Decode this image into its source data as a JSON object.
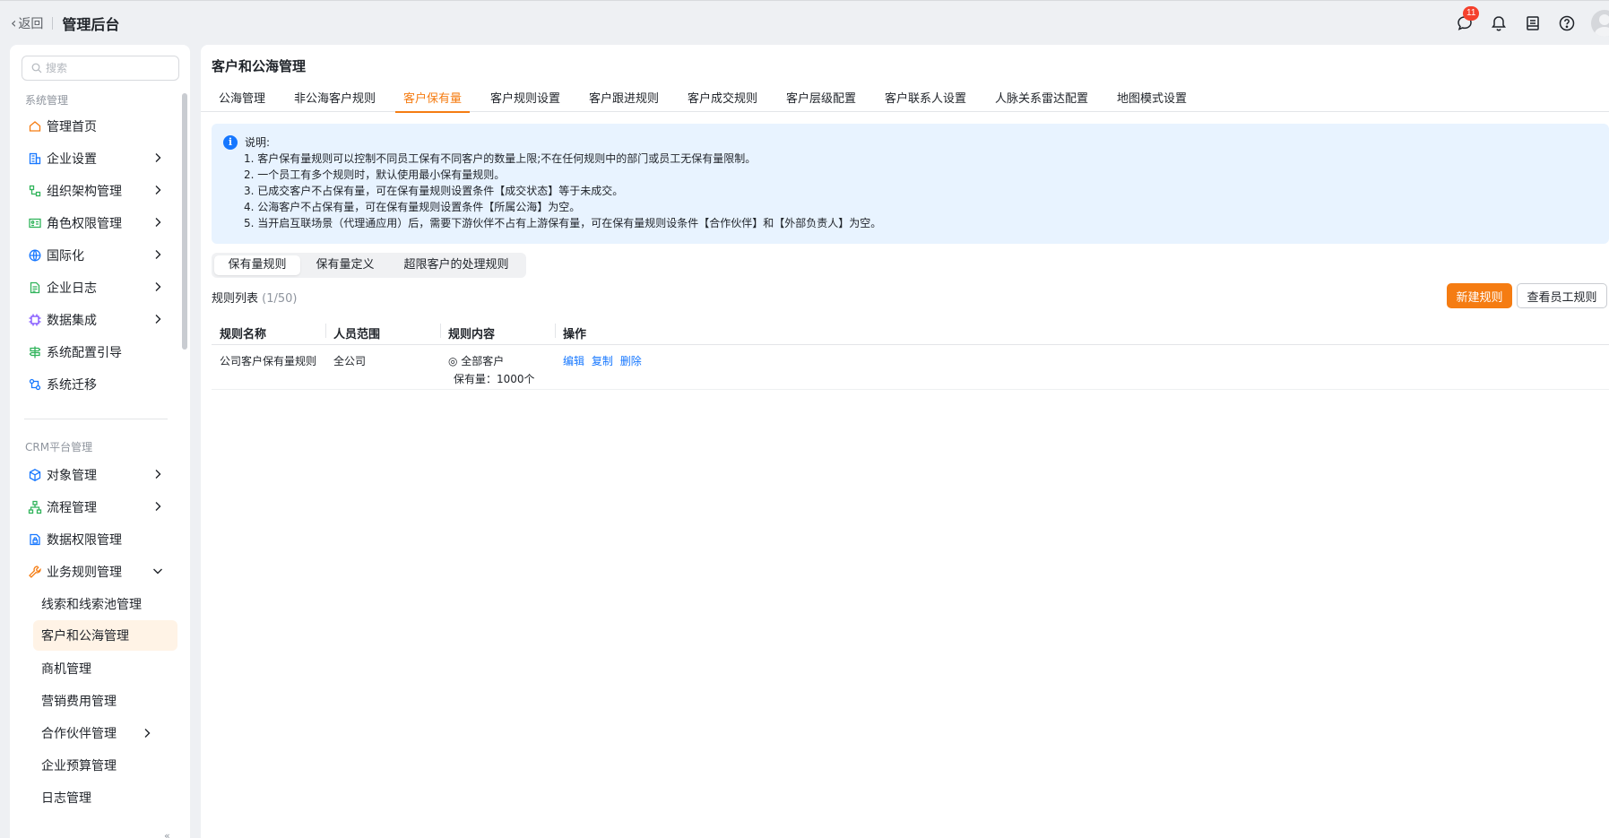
{
  "topbar": {
    "back_label": "返回",
    "title": "管理后台",
    "message_badge": "11"
  },
  "sidebar": {
    "search_placeholder": "搜索",
    "section_system": "系统管理",
    "system_items": [
      {
        "label": "管理首页",
        "icon": "home-icon"
      },
      {
        "label": "企业设置",
        "icon": "building-icon"
      },
      {
        "label": "组织架构管理",
        "icon": "org-icon"
      },
      {
        "label": "角色权限管理",
        "icon": "id-card-icon"
      },
      {
        "label": "国际化",
        "icon": "globe-icon"
      },
      {
        "label": "企业日志",
        "icon": "document-icon"
      },
      {
        "label": "数据集成",
        "icon": "chip-icon"
      },
      {
        "label": "系统配置引导",
        "icon": "signpost-icon"
      },
      {
        "label": "系统迁移",
        "icon": "migrate-icon"
      }
    ],
    "section_crm": "CRM平台管理",
    "crm_items": [
      {
        "label": "对象管理",
        "icon": "cube-icon"
      },
      {
        "label": "流程管理",
        "icon": "flow-icon"
      },
      {
        "label": "数据权限管理",
        "icon": "data-lock-icon"
      },
      {
        "label": "业务规则管理",
        "icon": "wrench-icon"
      }
    ],
    "sub_items": [
      {
        "label": "线索和线索池管理"
      },
      {
        "label": "客户和公海管理"
      },
      {
        "label": "商机管理"
      },
      {
        "label": "营销费用管理"
      },
      {
        "label": "合作伙伴管理"
      },
      {
        "label": "企业预算管理"
      },
      {
        "label": "日志管理"
      }
    ],
    "collapse_glyph": "«"
  },
  "main": {
    "title": "客户和公海管理",
    "tabs": [
      {
        "label": "公海管理"
      },
      {
        "label": "非公海客户规则"
      },
      {
        "label": "客户保有量"
      },
      {
        "label": "客户规则设置"
      },
      {
        "label": "客户跟进规则"
      },
      {
        "label": "客户成交规则"
      },
      {
        "label": "客户层级配置"
      },
      {
        "label": "客户联系人设置"
      },
      {
        "label": "人脉关系雷达配置"
      },
      {
        "label": "地图模式设置"
      }
    ],
    "active_tab": "客户保有量",
    "notice": {
      "title": "说明:",
      "lines": [
        "1. 客户保有量规则可以控制不同员工保有不同客户的数量上限;不在任何规则中的部门或员工无保有量限制。",
        "2. 一个员工有多个规则时，默认使用最小保有量规则。",
        "3. 已成交客户不占保有量，可在保有量规则设置条件【成交状态】等于未成交。",
        "4. 公海客户不占保有量，可在保有量规则设置条件【所属公海】为空。",
        "5. 当开启互联场景（代理通应用）后，需要下游伙伴不占有上游保有量，可在保有量规则设条件【合作伙伴】和【外部负责人】为空。"
      ]
    },
    "segments": [
      {
        "label": "保有量规则"
      },
      {
        "label": "保有量定义"
      },
      {
        "label": "超限客户的处理规则"
      }
    ],
    "list_title": "规则列表",
    "list_count": "(1/50)",
    "new_rule_button": "新建规则",
    "view_staff_rules_button": "查看员工规则",
    "table": {
      "headers": [
        "规则名称",
        "人员范围",
        "规则内容",
        "操作"
      ],
      "rows": [
        {
          "name": "公司客户保有量规则",
          "scope": "全公司",
          "content_line1": "◎ 全部客户",
          "content_line2": "保有量：1000个",
          "actions": [
            "编辑",
            "复制",
            "删除"
          ]
        }
      ]
    }
  },
  "colors": {
    "accent": "#f57c12",
    "link": "#1677ff",
    "notice_bg": "#e8f3ff",
    "badge": "#f5402c"
  }
}
